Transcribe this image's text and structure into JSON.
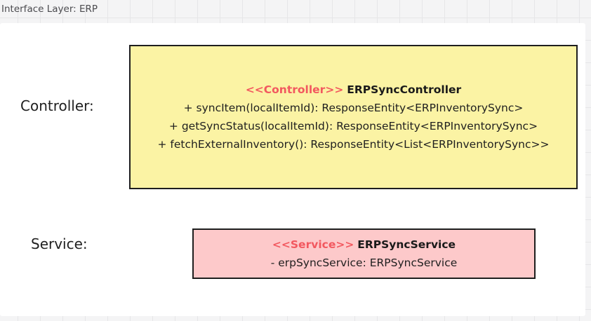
{
  "frame": {
    "title": "Interface Layer: ERP"
  },
  "rows": {
    "controller_label": "Controller:",
    "service_label": "Service:"
  },
  "controller_box": {
    "stereotype": "<<Controller>>",
    "class_name": "ERPSyncController",
    "methods": [
      "+ syncItem(localItemId): ResponseEntity<ERPInventorySync>",
      "+ getSyncStatus(localItemId): ResponseEntity<ERPInventorySync>",
      "+ fetchExternalInventory(): ResponseEntity<List<ERPInventorySync>>"
    ]
  },
  "service_box": {
    "stereotype": "<<Service>>",
    "class_name": "ERPSyncService",
    "fields": [
      "- erpSyncService: ERPSyncService"
    ]
  },
  "colors": {
    "controller_fill": "#fbf3a4",
    "service_fill": "#fdc9ca",
    "stereotype": "#f2585f",
    "border": "#1e1e1e"
  }
}
